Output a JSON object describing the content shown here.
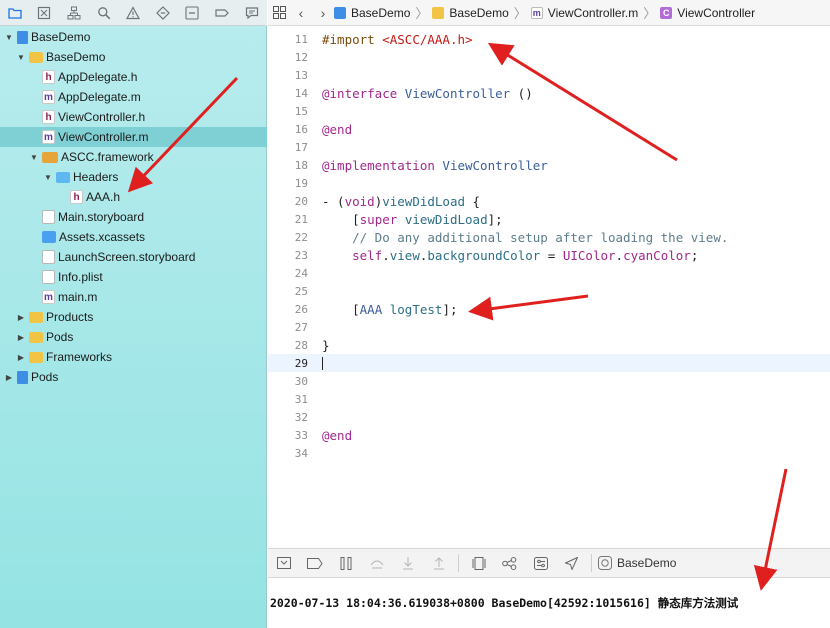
{
  "navigator": {
    "toolbar_icons": [
      "folder-icon",
      "source-control-icon",
      "hierarchy-icon",
      "search-icon",
      "warning-icon",
      "test-diamond-icon",
      "tag-icon",
      "breakpoint-icon",
      "report-icon"
    ],
    "tree": [
      {
        "label": "BaseDemo",
        "icon": "project-icon",
        "depth": 0,
        "disclosure": "open"
      },
      {
        "label": "BaseDemo",
        "icon": "folder-icon",
        "depth": 1,
        "disclosure": "open"
      },
      {
        "label": "AppDelegate.h",
        "icon": "header-file-icon",
        "depth": 2
      },
      {
        "label": "AppDelegate.m",
        "icon": "impl-file-icon",
        "depth": 2
      },
      {
        "label": "ViewController.h",
        "icon": "header-file-icon",
        "depth": 2
      },
      {
        "label": "ViewController.m",
        "icon": "impl-file-icon",
        "depth": 2,
        "selected": true
      },
      {
        "label": "ASCC.framework",
        "icon": "framework-icon",
        "depth": 2,
        "disclosure": "open"
      },
      {
        "label": "Headers",
        "icon": "blue-folder-icon",
        "depth": 3,
        "disclosure": "open"
      },
      {
        "label": "AAA.h",
        "icon": "header-file-icon",
        "depth": 4
      },
      {
        "label": "Main.storyboard",
        "icon": "storyboard-icon",
        "depth": 2
      },
      {
        "label": "Assets.xcassets",
        "icon": "assets-icon",
        "depth": 2
      },
      {
        "label": "LaunchScreen.storyboard",
        "icon": "storyboard-icon",
        "depth": 2
      },
      {
        "label": "Info.plist",
        "icon": "plist-icon",
        "depth": 2
      },
      {
        "label": "main.m",
        "icon": "impl-file-icon",
        "depth": 2
      },
      {
        "label": "Products",
        "icon": "folder-icon",
        "depth": 1,
        "disclosure": "closed"
      },
      {
        "label": "Pods",
        "icon": "folder-icon",
        "depth": 1,
        "disclosure": "closed"
      },
      {
        "label": "Frameworks",
        "icon": "folder-icon",
        "depth": 1,
        "disclosure": "closed"
      },
      {
        "label": "Pods",
        "icon": "project-icon",
        "depth": 0,
        "disclosure": "closed"
      }
    ]
  },
  "jumpbar": {
    "crumbs": [
      {
        "label": "BaseDemo",
        "icon": "project-icon"
      },
      {
        "label": "BaseDemo",
        "icon": "folder-icon"
      },
      {
        "label": "ViewController.m",
        "icon": "impl-file-icon"
      },
      {
        "label": "ViewController",
        "icon": "class-icon"
      }
    ]
  },
  "editor": {
    "current_line": 29,
    "lines": [
      {
        "n": "11",
        "code": "#import <ASCC/AAA.h>"
      },
      {
        "n": "12",
        "code": ""
      },
      {
        "n": "13",
        "code": ""
      },
      {
        "n": "14",
        "code": "@interface ViewController ()"
      },
      {
        "n": "15",
        "code": ""
      },
      {
        "n": "16",
        "code": "@end"
      },
      {
        "n": "17",
        "code": ""
      },
      {
        "n": "18",
        "code": "@implementation ViewController"
      },
      {
        "n": "19",
        "code": ""
      },
      {
        "n": "20",
        "code": "- (void)viewDidLoad {"
      },
      {
        "n": "21",
        "code": "    [super viewDidLoad];"
      },
      {
        "n": "22",
        "code": "    // Do any additional setup after loading the view."
      },
      {
        "n": "23",
        "code": "    self.view.backgroundColor = UIColor.cyanColor;"
      },
      {
        "n": "24",
        "code": ""
      },
      {
        "n": "25",
        "code": ""
      },
      {
        "n": "26",
        "code": "    [AAA logTest];"
      },
      {
        "n": "27",
        "code": ""
      },
      {
        "n": "28",
        "code": "}"
      },
      {
        "n": "29",
        "code": ""
      },
      {
        "n": "30",
        "code": ""
      },
      {
        "n": "31",
        "code": ""
      },
      {
        "n": "32",
        "code": ""
      },
      {
        "n": "33",
        "code": "@end"
      },
      {
        "n": "34",
        "code": ""
      }
    ]
  },
  "debugbar": {
    "icons": [
      "hide-debug-area-icon",
      "breakpoints-toggle-icon",
      "pause-icon",
      "step-over-icon",
      "step-into-icon",
      "step-out-icon",
      "view-debugger-icon",
      "memory-graph-icon",
      "environment-overrides-icon",
      "simulate-location-icon"
    ],
    "target_label": "BaseDemo"
  },
  "console": {
    "output": "2020-07-13 18:04:36.619038+0800 BaseDemo[42592:1015616] 静态库方法测试"
  },
  "colors": {
    "sidebar_bg": "#95e3e3",
    "selected_row": "#7fd0d4",
    "annotation_arrow": "#e0201f",
    "keyword": "#a2288d",
    "string": "#c41a16"
  }
}
